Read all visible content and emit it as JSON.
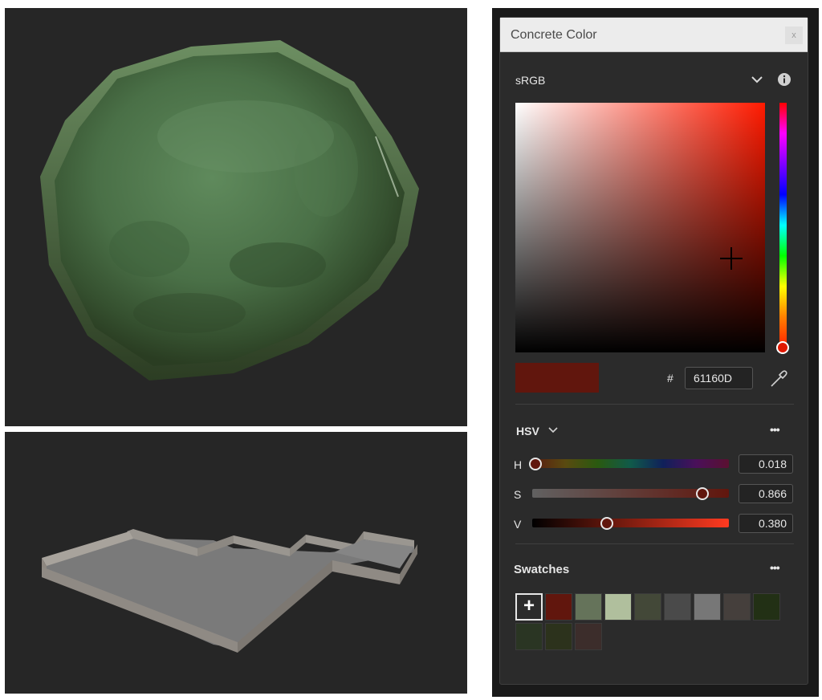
{
  "dialog": {
    "title": "Concrete Color",
    "close_label": "x",
    "color_space": "sRGB",
    "hash_label": "#",
    "hex_value": "61160D",
    "current_color": "#61160d",
    "model_label": "HSV",
    "sliders": [
      {
        "label": "H",
        "value": "0.018",
        "fraction": 0.018,
        "knob_color": "#61160d"
      },
      {
        "label": "S",
        "value": "0.866",
        "fraction": 0.866,
        "knob_color": "#61160d"
      },
      {
        "label": "V",
        "value": "0.380",
        "fraction": 0.38,
        "knob_color": "#61160d"
      }
    ],
    "more_label": "•••",
    "swatches_label": "Swatches",
    "add_swatch_label": "+",
    "swatches": [
      "#61160d",
      "#65735a",
      "#b0bf9d",
      "#434838",
      "#4a4a4a",
      "#777777",
      "#453f3c",
      "#223015",
      "#2a3523",
      "#2c321c",
      "#3c2d2b"
    ]
  }
}
